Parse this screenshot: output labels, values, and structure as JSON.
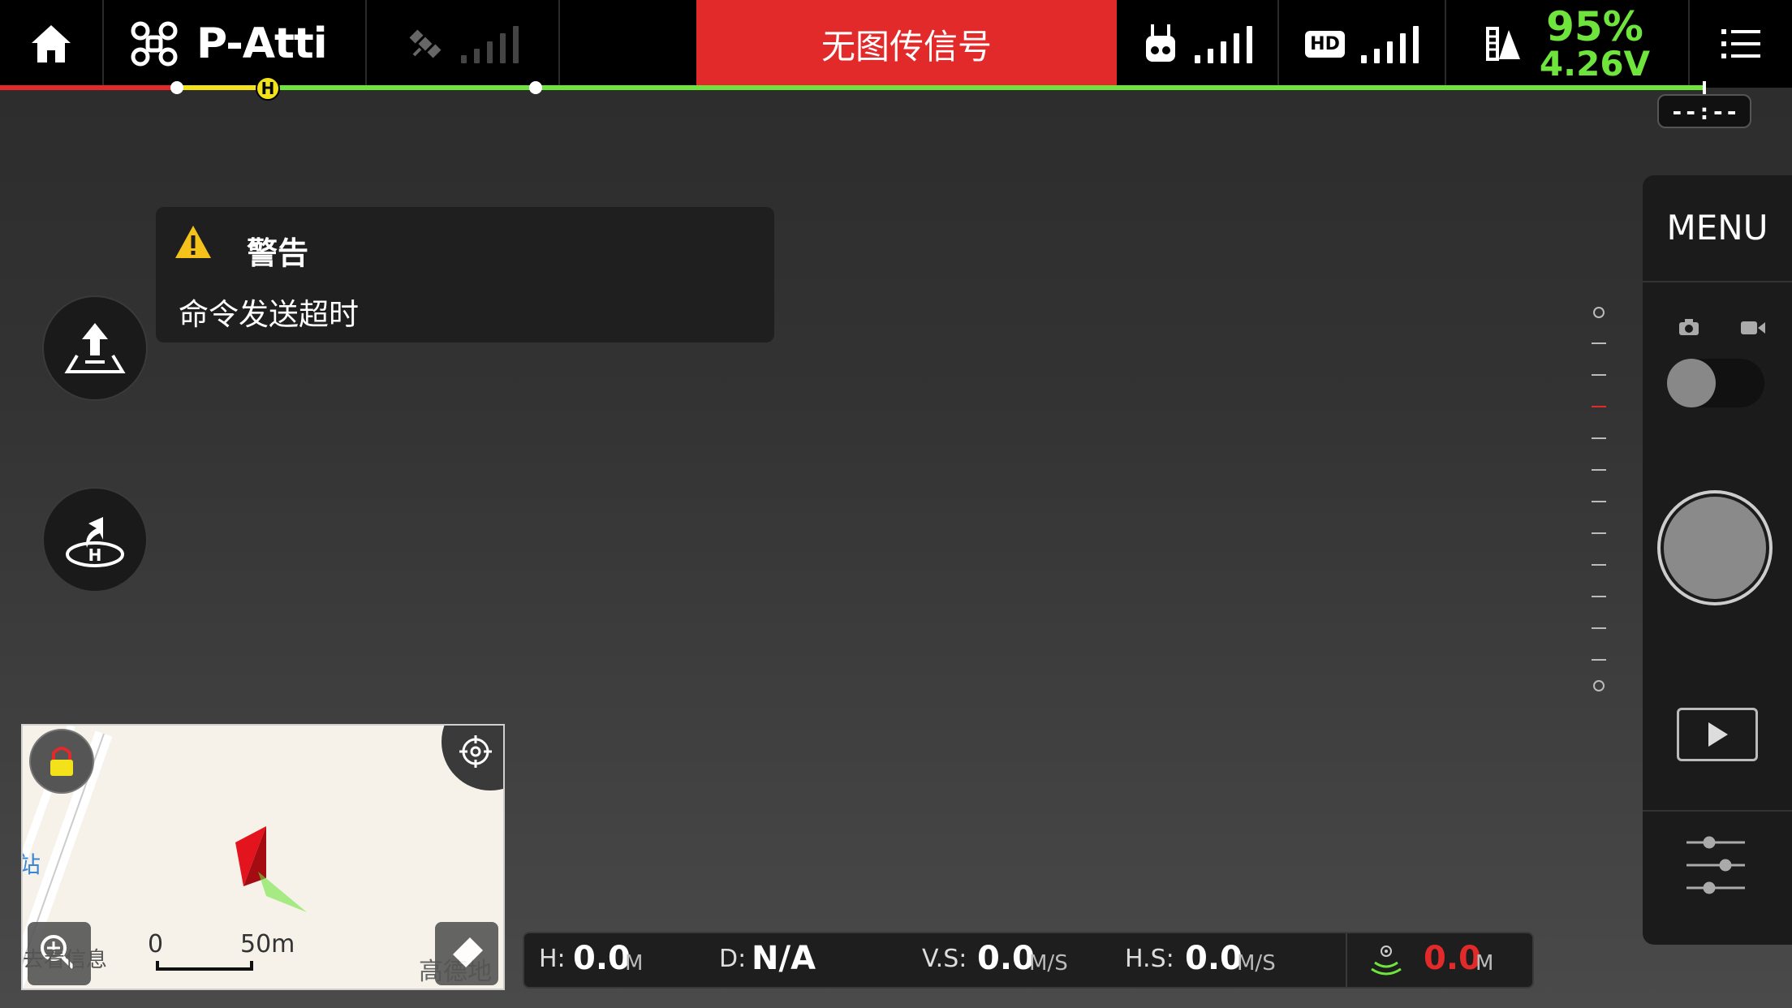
{
  "topbar": {
    "flight_mode": "P-Atti",
    "alert": "无图传信号",
    "battery_percent": "95%",
    "battery_voltage": "4.26V"
  },
  "timer": "--:--",
  "warning": {
    "title": "警告",
    "message": "命令发送超时"
  },
  "right_panel": {
    "menu_label": "MENU"
  },
  "map": {
    "scale_zero": "0",
    "scale_distance": "50m",
    "label_station": "站",
    "label_info": "去看信息",
    "label_gaode": "高德地"
  },
  "telemetry": {
    "h_label": "H:",
    "h_value": "0.0",
    "h_unit": "M",
    "d_label": "D:",
    "d_value": "N/A",
    "vs_label": "V.S:",
    "vs_value": "0.0",
    "vs_unit": "M/S",
    "hs_label": "H.S:",
    "hs_value": "0.0",
    "hs_unit": "M/S",
    "sensor_value": "0.0",
    "sensor_unit": "M"
  },
  "colors": {
    "alert_red": "#e32a2b",
    "battery_green": "#6fe43c",
    "home_yellow": "#f3e21a"
  }
}
